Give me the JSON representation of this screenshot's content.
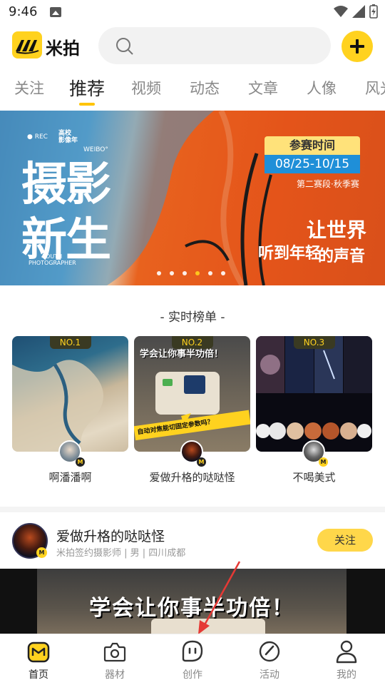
{
  "status_bar": {
    "time": "9:46"
  },
  "header": {
    "app_name": "米拍",
    "accent": "#ffd21f"
  },
  "tabs": [
    {
      "label": "关注",
      "active": false
    },
    {
      "label": "推荐",
      "active": true
    },
    {
      "label": "视频",
      "active": false
    },
    {
      "label": "动态",
      "active": false
    },
    {
      "label": "文章",
      "active": false
    },
    {
      "label": "人像",
      "active": false
    },
    {
      "label": "风光",
      "active": false
    }
  ],
  "banner": {
    "rec": "● REC",
    "org_line1": "高校",
    "org_line2": "影像年",
    "weibo": "WEIBO°",
    "title_line1": "摄影",
    "title_line2": "新生",
    "youth_line1": "YOUTH",
    "youth_line2": "PHOTOGRAPHER",
    "badge_top": "参赛时间",
    "badge_date": "08/25-10/15",
    "stage": "第二赛段·秋季赛",
    "slogan1": "让世界",
    "slogan2": "听到年轻",
    "slogan3": "的声音",
    "slides": 6,
    "active_slide": 4
  },
  "ranking": {
    "title": "- 实时榜单 -",
    "items": [
      {
        "rank": "NO.1",
        "name": "啊潘潘啊"
      },
      {
        "rank": "NO.2",
        "name": "爱做升格的哒哒怪",
        "overlay_top": "学会让你事半功倍！",
        "overlay_bottom": "自动对焦能切固定参数吗？"
      },
      {
        "rank": "NO.3",
        "name": "不喝美式"
      }
    ]
  },
  "feed": {
    "author": "爱做升格的哒哒怪",
    "description": "米拍签约摄影师 | 男 | 四川成都",
    "follow_label": "关注",
    "caption": "学会让你事半功倍！"
  },
  "bottom_nav": [
    {
      "label": "首页",
      "icon": "home-m-icon",
      "active": true
    },
    {
      "label": "器材",
      "icon": "camera-bag-icon",
      "active": false
    },
    {
      "label": "创作",
      "icon": "create-face-icon",
      "active": false
    },
    {
      "label": "活动",
      "icon": "activity-icon",
      "active": false
    },
    {
      "label": "我的",
      "icon": "profile-icon",
      "active": false
    }
  ]
}
